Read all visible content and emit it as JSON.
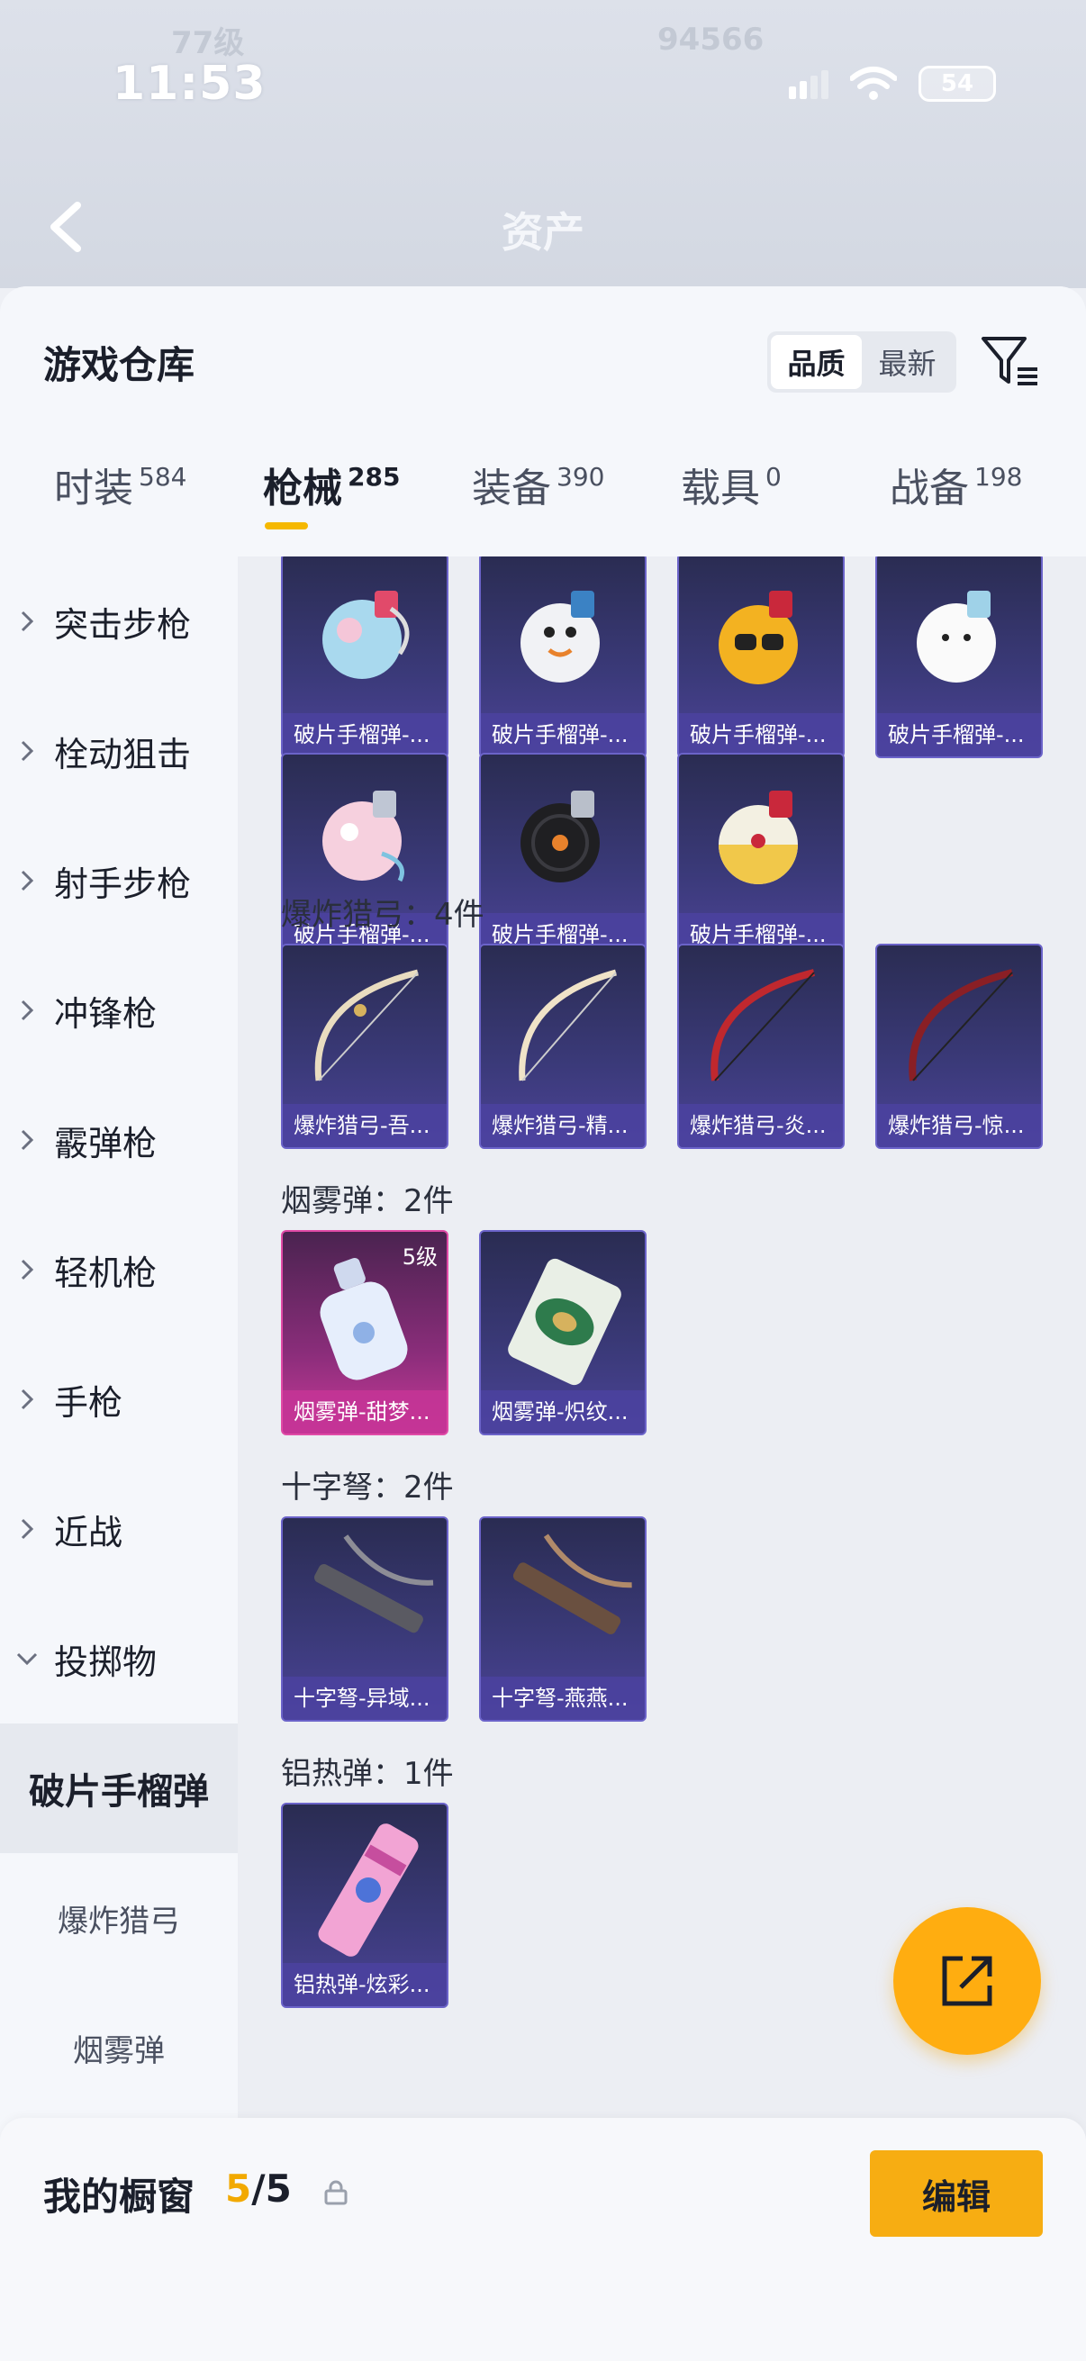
{
  "status_bar": {
    "time": "11:53",
    "battery": "54"
  },
  "header": {
    "title": "资产"
  },
  "panel": {
    "title": "游戏仓库"
  },
  "sort": {
    "options": [
      "品质",
      "最新"
    ],
    "selected": "品质"
  },
  "tabs": [
    {
      "label": "时装",
      "count": "584"
    },
    {
      "label": "枪械",
      "count": "285"
    },
    {
      "label": "装备",
      "count": "390"
    },
    {
      "label": "载具",
      "count": "0"
    },
    {
      "label": "战备",
      "count": "198"
    }
  ],
  "active_tab": "枪械",
  "sidebar": {
    "categories": [
      "突击步枪",
      "栓动狙击",
      "射手步枪",
      "冲锋枪",
      "霰弹枪",
      "轻机枪",
      "手枪",
      "近战",
      "投掷物"
    ],
    "sub_items": [
      "破片手榴弹",
      "爆炸猎弓",
      "烟雾弹"
    ],
    "active_sub": "破片手榴弹"
  },
  "sections": [
    {
      "title": "",
      "items": [
        {
          "label": "破片手榴弹-...",
          "art": "grenade-icon",
          "color": "#9fd7f0"
        },
        {
          "label": "破片手榴弹-...",
          "art": "grenade-icon",
          "color": "#f5f5f5"
        },
        {
          "label": "破片手榴弹-...",
          "art": "grenade-icon",
          "color": "#f3b221"
        },
        {
          "label": "破片手榴弹-...",
          "art": "grenade-icon",
          "color": "#ffffff"
        },
        {
          "label": "破片手榴弹-...",
          "art": "grenade-icon",
          "color": "#f6c9d6"
        },
        {
          "label": "破片手榴弹-...",
          "art": "grenade-icon",
          "color": "#222222"
        },
        {
          "label": "破片手榴弹-...",
          "art": "grenade-icon",
          "color": "#f1c84a"
        }
      ]
    },
    {
      "title": "爆炸猎弓：4件",
      "items": [
        {
          "label": "爆炸猎弓-吾...",
          "art": "bow-icon",
          "color": "#e9dcc0"
        },
        {
          "label": "爆炸猎弓-精...",
          "art": "bow-icon",
          "color": "#f0e3c8"
        },
        {
          "label": "爆炸猎弓-炎...",
          "art": "bow-icon",
          "color": "#c0282e"
        },
        {
          "label": "爆炸猎弓-惊...",
          "art": "bow-icon",
          "color": "#8a1f25"
        }
      ]
    },
    {
      "title": "烟雾弹：2件",
      "items": [
        {
          "label": "烟雾弹-甜梦...",
          "art": "bottle-icon",
          "color": "#e6eefc",
          "level": "5级",
          "rarity": "pink"
        },
        {
          "label": "烟雾弹-炽纹...",
          "art": "canister-icon",
          "color": "#2e7b4c"
        }
      ]
    },
    {
      "title": "十字弩：2件",
      "items": [
        {
          "label": "十字弩-异域...",
          "art": "crossbow-icon",
          "color": "#8d8d96"
        },
        {
          "label": "十字弩-燕燕...",
          "art": "crossbow-icon",
          "color": "#b08a6a"
        }
      ]
    },
    {
      "title": "铝热弹：1件",
      "items": [
        {
          "label": "铝热弹-炫彩...",
          "art": "thermite-icon",
          "color": "#f2a4d4"
        }
      ]
    }
  ],
  "showcase": {
    "title": "我的橱窗",
    "current": "5",
    "sep_total": "/5",
    "edit_label": "编辑"
  }
}
